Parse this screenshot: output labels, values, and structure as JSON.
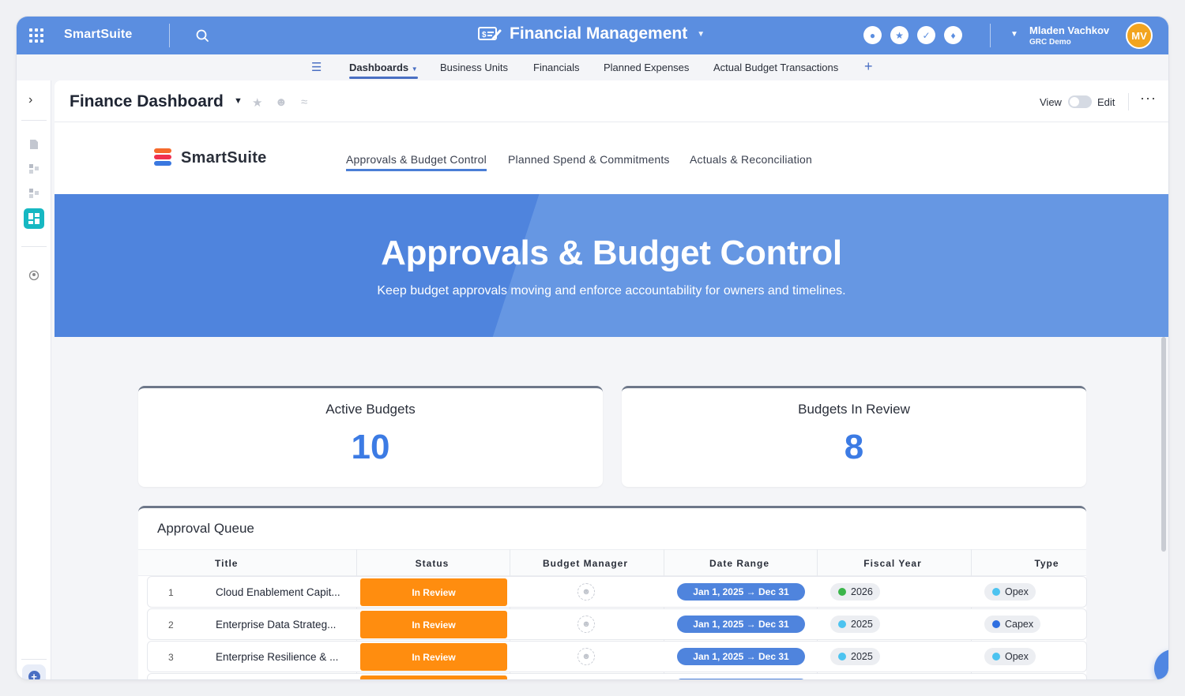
{
  "topbar": {
    "brand": "SmartSuite",
    "app_title": "Financial Management",
    "user_name": "Mladen Vachkov",
    "user_org": "GRC Demo",
    "avatar_initials": "MV",
    "accent_color": "#5b8ee0"
  },
  "subnav": {
    "tabs": [
      {
        "label": "Dashboards",
        "active": true
      },
      {
        "label": "Business Units"
      },
      {
        "label": "Financials"
      },
      {
        "label": "Planned Expenses"
      },
      {
        "label": "Actual Budget Transactions"
      }
    ],
    "add_label": "+"
  },
  "panel": {
    "title": "Finance Dashboard",
    "view_label": "View",
    "edit_label": "Edit",
    "more_label": "···"
  },
  "dashboard_nav": {
    "logo_text": "SmartSuite",
    "tabs": [
      {
        "label": "Approvals & Budget Control",
        "active": true
      },
      {
        "label": "Planned Spend & Commitments"
      },
      {
        "label": "Actuals & Reconciliation"
      }
    ]
  },
  "hero": {
    "title": "Approvals & Budget Control",
    "subtitle": "Keep budget approvals moving and enforce accountability for owners and timelines."
  },
  "metrics": [
    {
      "label": "Active Budgets",
      "value": "10"
    },
    {
      "label": "Budgets In Review",
      "value": "8"
    }
  ],
  "queue": {
    "title": "Approval Queue",
    "columns": [
      "Title",
      "Status",
      "Budget Manager",
      "Date Range",
      "Fiscal Year",
      "Type"
    ],
    "rows": [
      {
        "num": "1",
        "title": "Cloud Enablement Capit...",
        "status": "In Review",
        "date": "Jan 1, 2025 → Dec 31",
        "year": "2026",
        "year_color": "#3bb54a",
        "type": "Opex",
        "type_color": "#4cc3f0"
      },
      {
        "num": "2",
        "title": "Enterprise Data Strateg...",
        "status": "In Review",
        "date": "Jan 1, 2025 → Dec 31",
        "year": "2025",
        "year_color": "#4cc3f0",
        "type": "Capex",
        "type_color": "#2f6fe0"
      },
      {
        "num": "3",
        "title": "Enterprise Resilience & ...",
        "status": "In Review",
        "date": "Jan 1, 2025 → Dec 31",
        "year": "2025",
        "year_color": "#4cc3f0",
        "type": "Opex",
        "type_color": "#4cc3f0"
      }
    ]
  },
  "status_color": "#ff8d0f"
}
